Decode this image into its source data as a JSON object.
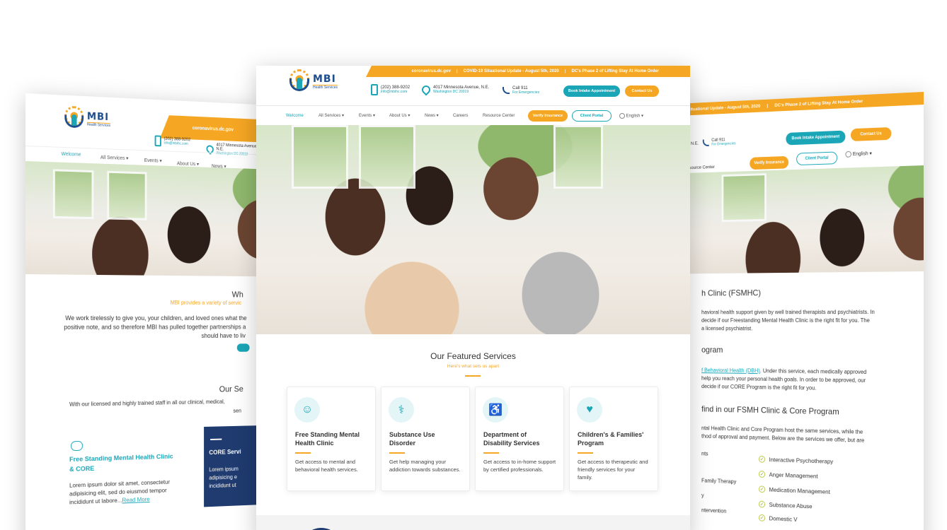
{
  "brand": {
    "logo_big": "MBI",
    "logo_small": "Health Services"
  },
  "top_strip": {
    "link1": "coronavirus.dc.gov",
    "link2": "COVID-19 Situational Update - August 5th, 2020",
    "link3": "DC's Phase 2 of Lifting Stay At Home Order",
    "sep": "|"
  },
  "contact": {
    "phone": "(202) 388-9202",
    "email": "info@mbihc.com",
    "address": "4017 Minnesota Avenue, N.E.",
    "city": "Washington DC 20019",
    "emergency": "Call 911",
    "emergency_sub": "For Emergencies"
  },
  "buttons": {
    "book": "Book Intake Appointment",
    "contact": "Contact Us",
    "verify": "Verify Insurance",
    "portal": "Client Portal"
  },
  "nav": {
    "welcome": "Welcome",
    "services": "All Services ▾",
    "events": "Events ▾",
    "about": "About Us ▾",
    "news": "News ▾",
    "careers": "Careers",
    "resource": "Resource Center",
    "language": "English ▾"
  },
  "featured": {
    "title": "Our Featured Services",
    "subtitle": "Here's what sets us apart",
    "cards": [
      {
        "title": "Free Standing Mental Health Clinic",
        "text": "Get access to mental and behavioral health services.",
        "icon": "☺"
      },
      {
        "title": "Substance Use Disorder",
        "text": "Get help managing your addiction towards substances.",
        "icon": "⚕"
      },
      {
        "title": "Department of Disability Services",
        "text": "Get access to in-home support by certified professionals.",
        "icon": "♿"
      },
      {
        "title": "Children's & Families' Program",
        "text": "Get access to therapeutic and friendly services for your family.",
        "icon": "♥"
      }
    ]
  },
  "left_page": {
    "heading": "Wh",
    "intro_orange": "MBI provides a variety of servic",
    "para1": "We work tirelessly to give you, your children, and loved ones what the",
    "para2": "positive note, and so therefore MBI has pulled together partnerships a",
    "para3": "should have to liv",
    "section2": "Our Se",
    "section2_text": "With our licensed and highly trained staff in all our clinical, medical,",
    "section2_tail": "sen",
    "clinic_title1": "Free Standing Mental Health Clinic",
    "clinic_title2": "& CORE",
    "clinic_text1": "Lorem ipsum dolor sit amet, consectetur",
    "clinic_text2": "adipisicing elit, sed do eiusmod tempor",
    "clinic_text3": "incididunt ut labore...",
    "read_more": "Read More",
    "core_title": "CORE Servi",
    "core_text1": "Lorem ipsum",
    "core_text2": "adipisicing e",
    "core_text3": "incididunt ut"
  },
  "right_page": {
    "strip_text": "Situational Update - August 5th, 2020",
    "strip_text2": "DC's Phase 2 of Lifting Stay At Home Order",
    "address_tail": "ue, N.E.",
    "clinic_heading": "h Clinic (FSMHC)",
    "p1a": "havioral health support given by well trained therapists and psychiatrists. In",
    "p1b": "decide if our Freestanding Mental Health Clinic is the right fit for you. The",
    "p1c": "a licensed psychiatrist.",
    "program_heading": "ogram",
    "p2a_link": "f Behavioral Health (DBH)",
    "p2a": ". Under this service, each medically approved",
    "p2b": "help you reach your personal health goals. In order to be approved, our",
    "p2c": "decide if our CORE Program is the right fit for you.",
    "find_heading": "find in our FSMH Clinic & Core Program",
    "p3a": "ntal Health Clinic and Core Program host the same services, while the",
    "p3b": "thod of approval and payment. Below are the services we offer, but are",
    "list_left": [
      "nts",
      "Family Therapy",
      "y",
      "ntervention"
    ],
    "list_right": [
      "Interactive Psychotherapy",
      "Anger Management",
      "Medication Management",
      "Substance Abuse",
      "Domestic V"
    ]
  },
  "colors": {
    "orange": "#f5a623",
    "teal": "#1aa6b7",
    "navy": "#1f4e8c"
  }
}
